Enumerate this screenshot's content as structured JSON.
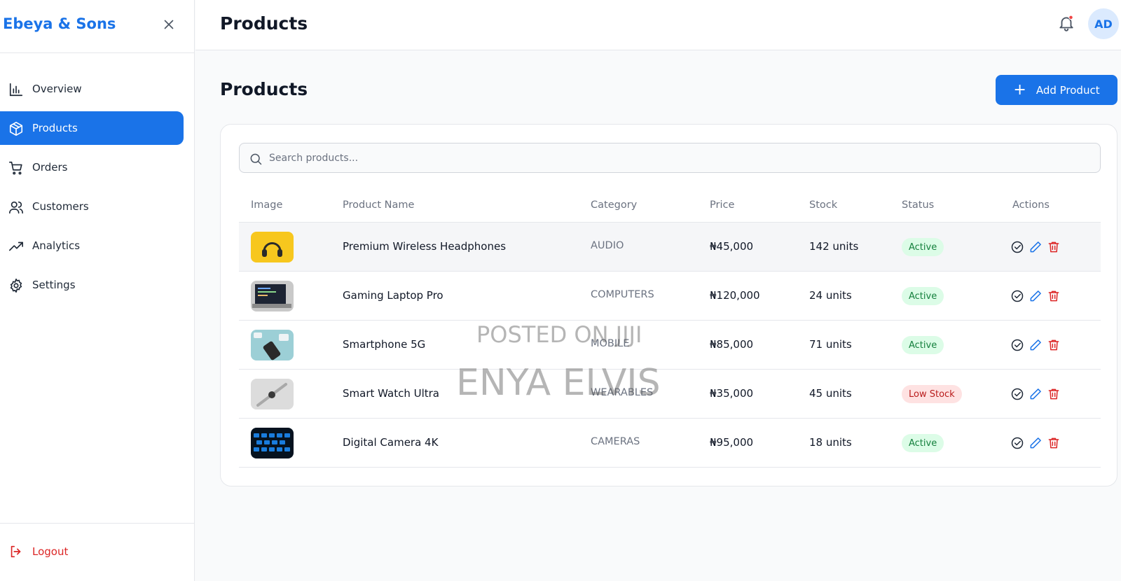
{
  "brand": "Ebeya & Sons",
  "sidebar": {
    "items": [
      {
        "label": "Overview",
        "icon": "bar-chart-icon"
      },
      {
        "label": "Products",
        "icon": "package-icon"
      },
      {
        "label": "Orders",
        "icon": "cart-icon"
      },
      {
        "label": "Customers",
        "icon": "users-icon"
      },
      {
        "label": "Analytics",
        "icon": "trending-up-icon"
      },
      {
        "label": "Settings",
        "icon": "gear-icon"
      }
    ],
    "active": "Products",
    "logout_label": "Logout"
  },
  "topbar": {
    "title": "Products",
    "avatar_initials": "AD",
    "notification_dot": true
  },
  "main": {
    "title": "Products",
    "add_button_label": "Add Product",
    "search": {
      "placeholder": "Search products...",
      "value": ""
    },
    "table": {
      "columns": [
        "Image",
        "Product Name",
        "Category",
        "Price",
        "Stock",
        "Status",
        "Actions"
      ],
      "rows": [
        {
          "name": "Premium Wireless Headphones",
          "category": "AUDIO",
          "price": "₦45,000",
          "stock": "142 units",
          "status": "Active"
        },
        {
          "name": "Gaming Laptop Pro",
          "category": "COMPUTERS",
          "price": "₦120,000",
          "stock": "24 units",
          "status": "Active"
        },
        {
          "name": "Smartphone 5G",
          "category": "MOBILE",
          "price": "₦85,000",
          "stock": "71 units",
          "status": "Active"
        },
        {
          "name": "Smart Watch Ultra",
          "category": "WEARABLES",
          "price": "₦35,000",
          "stock": "45 units",
          "status": "Low Stock"
        },
        {
          "name": "Digital Camera 4K",
          "category": "CAMERAS",
          "price": "₦95,000",
          "stock": "18 units",
          "status": "Active"
        }
      ]
    }
  },
  "watermark": {
    "line1": "POSTED ON JIJI",
    "line2": "ENYA ELVIS"
  },
  "colors": {
    "accent": "#1a73e8",
    "danger": "#dc2626",
    "active_badge_bg": "#dcfce7",
    "active_badge_text": "#15803d",
    "low_badge_bg": "#fee2e2",
    "low_badge_text": "#b91c1c"
  }
}
